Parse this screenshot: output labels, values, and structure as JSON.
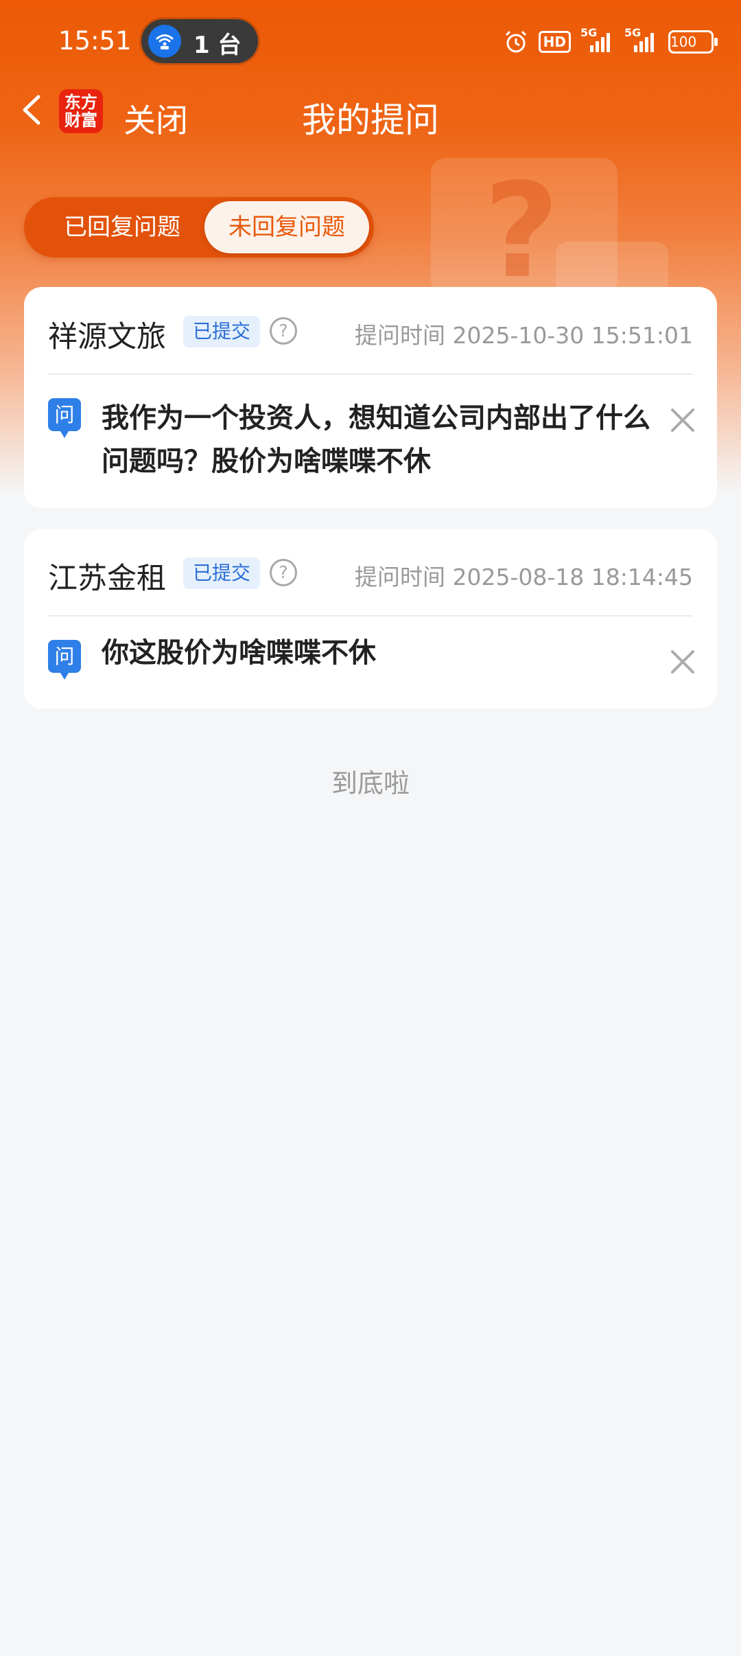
{
  "status_bar": {
    "time": "15:51",
    "hotspot_count": "1 台",
    "hd_badge": "HD",
    "network_1": "5G",
    "network_2": "5G",
    "battery": "100",
    "icons": [
      "alarm-icon",
      "hd-icon",
      "signal-icon",
      "signal-icon",
      "battery-icon"
    ]
  },
  "nav": {
    "logo_line1": "东方",
    "logo_line2": "财富",
    "close_label": "关闭",
    "title": "我的提问"
  },
  "tabs": {
    "replied": "已回复问题",
    "unreplied": "未回复问题",
    "active": "unreplied"
  },
  "questions": [
    {
      "company": "祥源文旅",
      "status": "已提交",
      "time": "提问时间 2025-10-30 15:51:01",
      "q_label": "问",
      "question": "我作为一个投资人，想知道公司内部出了什么问题吗？股价为啥喋喋不休"
    },
    {
      "company": "江苏金租",
      "status": "已提交",
      "time": "提问时间 2025-08-18 18:14:45",
      "q_label": "问",
      "question": "你这股价为啥喋喋不休"
    }
  ],
  "footer": {
    "end_text": "到底啦"
  },
  "colors": {
    "accent": "#ec5a06",
    "badge_bg": "#e6f0fc",
    "badge_text": "#2b6fd6",
    "question_icon": "#2f7fe8"
  }
}
